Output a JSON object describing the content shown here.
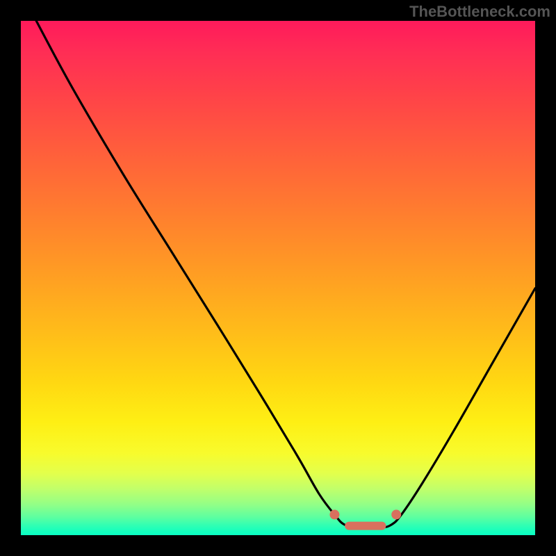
{
  "watermark": "TheBottleneck.com",
  "chart_data": {
    "type": "line",
    "title": "",
    "xlabel": "",
    "ylabel": "",
    "xlim": [
      0,
      100
    ],
    "ylim": [
      0,
      100
    ],
    "grid": false,
    "legend": false,
    "description": "Bottleneck severity curve over a red-to-green gradient. Y near 100 = severe bottleneck (red), Y near 0 = balanced (green). Curve drops from top-left to a flat minimum near x≈63–72 then rises toward the right.",
    "series": [
      {
        "name": "bottleneck-curve",
        "x": [
          3,
          10,
          20,
          30,
          40,
          48,
          54,
          58,
          61,
          63,
          66,
          70,
          72,
          74,
          78,
          84,
          92,
          100
        ],
        "y": [
          100,
          87,
          70,
          54,
          38,
          25,
          15,
          8,
          4,
          2,
          1.5,
          1.5,
          2,
          4,
          10,
          20,
          34,
          48
        ]
      }
    ],
    "markers": {
      "left_dot": {
        "x": 61,
        "y": 4
      },
      "right_dot": {
        "x": 73,
        "y": 4
      },
      "pill": {
        "x0": 63,
        "x1": 71,
        "y": 1.8
      }
    }
  }
}
